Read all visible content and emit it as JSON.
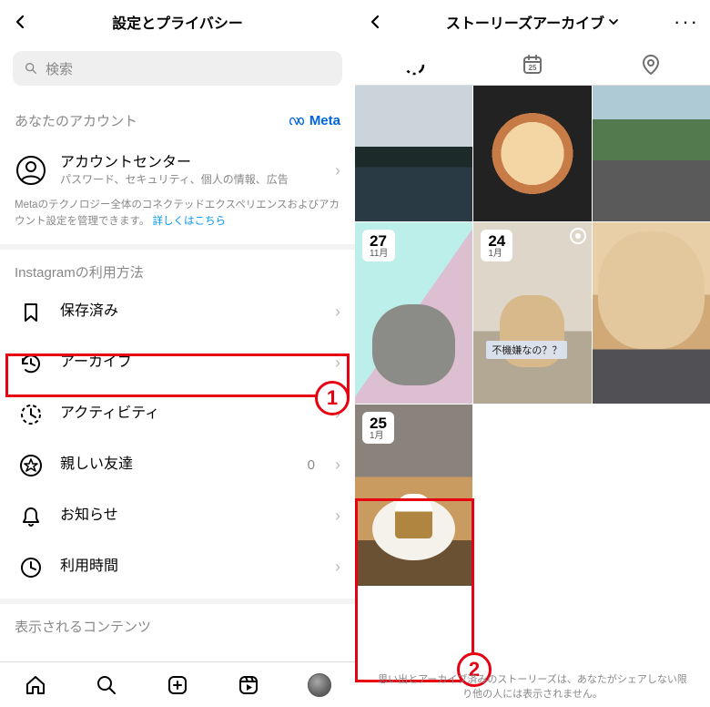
{
  "left": {
    "header_title": "設定とプライバシー",
    "search_placeholder": "検索",
    "your_account_label": "あなたのアカウント",
    "meta_label": "Meta",
    "account_center": {
      "title": "アカウントセンター",
      "subtitle": "パスワード、セキュリティ、個人の情報、広告"
    },
    "meta_note_prefix": "Metaのテクノロジー全体のコネクテッドエクスペリエンスおよびアカウント設定を管理できます。",
    "meta_note_link": "詳しくはこちら",
    "usage_header": "Instagramの利用方法",
    "items": [
      {
        "label": "保存済み"
      },
      {
        "label": "アーカイブ"
      },
      {
        "label": "アクティビティ"
      },
      {
        "label": "親しい友達",
        "count": "0"
      },
      {
        "label": "お知らせ"
      },
      {
        "label": "利用時間"
      }
    ],
    "content_header": "表示されるコンテンツ"
  },
  "right": {
    "header_title": "ストーリーズアーカイブ",
    "tiles": [
      {
        "id": "town"
      },
      {
        "id": "pizza"
      },
      {
        "id": "road"
      },
      {
        "id": "graycat",
        "day": "27",
        "month": "11月"
      },
      {
        "id": "sitcat",
        "day": "24",
        "month": "1月",
        "caption": "不機嫌なの？？"
      },
      {
        "id": "closecat"
      },
      {
        "id": "cake",
        "day": "25",
        "month": "1月"
      }
    ],
    "footer_note": "思い出とアーカイブ済みのストーリーズは、あなたがシェアしない限り他の人には表示されません。"
  },
  "annotations": {
    "one": "1",
    "two": "2"
  }
}
